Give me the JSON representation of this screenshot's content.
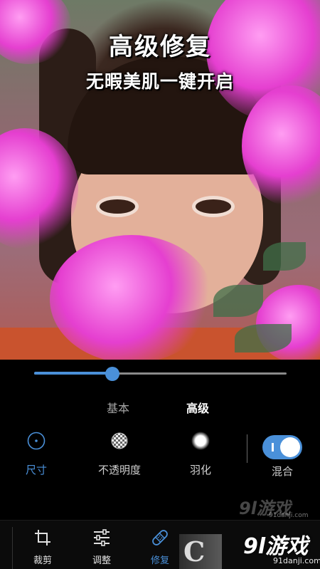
{
  "photo": {
    "headline": "高级修复",
    "subline": "无暇美肌一键开启"
  },
  "slider": {
    "level_fraction": 0.31
  },
  "modes": {
    "basic": "基本",
    "advanced": "高级",
    "active": "advanced"
  },
  "tools": [
    {
      "label": "尺寸",
      "icon": "circle-dot-icon",
      "active": true
    },
    {
      "label": "不透明度",
      "icon": "checker-opacity-icon",
      "active": false
    },
    {
      "label": "羽化",
      "icon": "feather-glow-icon",
      "active": false
    }
  ],
  "blend": {
    "label": "混合",
    "enabled": true
  },
  "bottom_nav": [
    {
      "label": "裁剪",
      "icon": "crop-icon",
      "active": false
    },
    {
      "label": "调整",
      "icon": "sliders-icon",
      "active": false
    },
    {
      "label": "修复",
      "icon": "bandage-icon",
      "active": true
    }
  ],
  "watermark": {
    "brand": "9l游戏",
    "url": "91danji.com"
  },
  "colors": {
    "accent": "#4a90d9",
    "background": "#000000",
    "inactive_text": "#a5a5a5"
  }
}
